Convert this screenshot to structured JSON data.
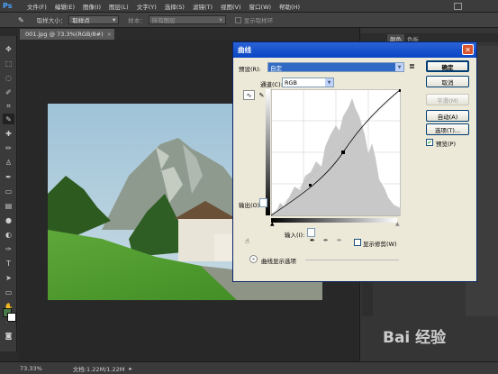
{
  "app": {
    "logo": "Ps"
  },
  "menubar": {
    "items": [
      "文件(F)",
      "编辑(E)",
      "图像(I)",
      "图层(L)",
      "文字(Y)",
      "选择(S)",
      "滤镜(T)",
      "视图(V)",
      "窗口(W)",
      "帮助(H)"
    ]
  },
  "options": {
    "sample_size_label": "取样大小：",
    "sample_size_value": "取样点",
    "sample_label": "样本：",
    "sample_value": "所有图层",
    "show_ring_label": "显示取样环"
  },
  "document": {
    "tab_title": "001.jpg @ 73.3%(RGB/8#)"
  },
  "status": {
    "zoom": "73.33%",
    "doc_info": "文档:1.22M/1.22M"
  },
  "dialog": {
    "title": "曲线",
    "preset_label": "预设(R):",
    "preset_value": "自定",
    "channel_label": "通道(C):",
    "channel_value": "RGB",
    "output_label": "输出(O):",
    "input_label": "输入(I):",
    "show_clipping_label": "显示修剪(W)",
    "curve_options_label": "曲线显示选项",
    "buttons": {
      "ok": "确定",
      "cancel": "取消",
      "smooth": "平滑(M)",
      "auto": "自动(A)",
      "options": "选项(T)...",
      "preview": "预览(P)"
    },
    "preview_checked": true
  },
  "panels": {
    "tabs": [
      "颜色",
      "色板"
    ]
  },
  "watermark": "Bai 经验",
  "colors": {
    "dialog_bg": "#ece9d8",
    "titlebar": "#0a46c4",
    "ps_dark": "#2b2b2b"
  }
}
